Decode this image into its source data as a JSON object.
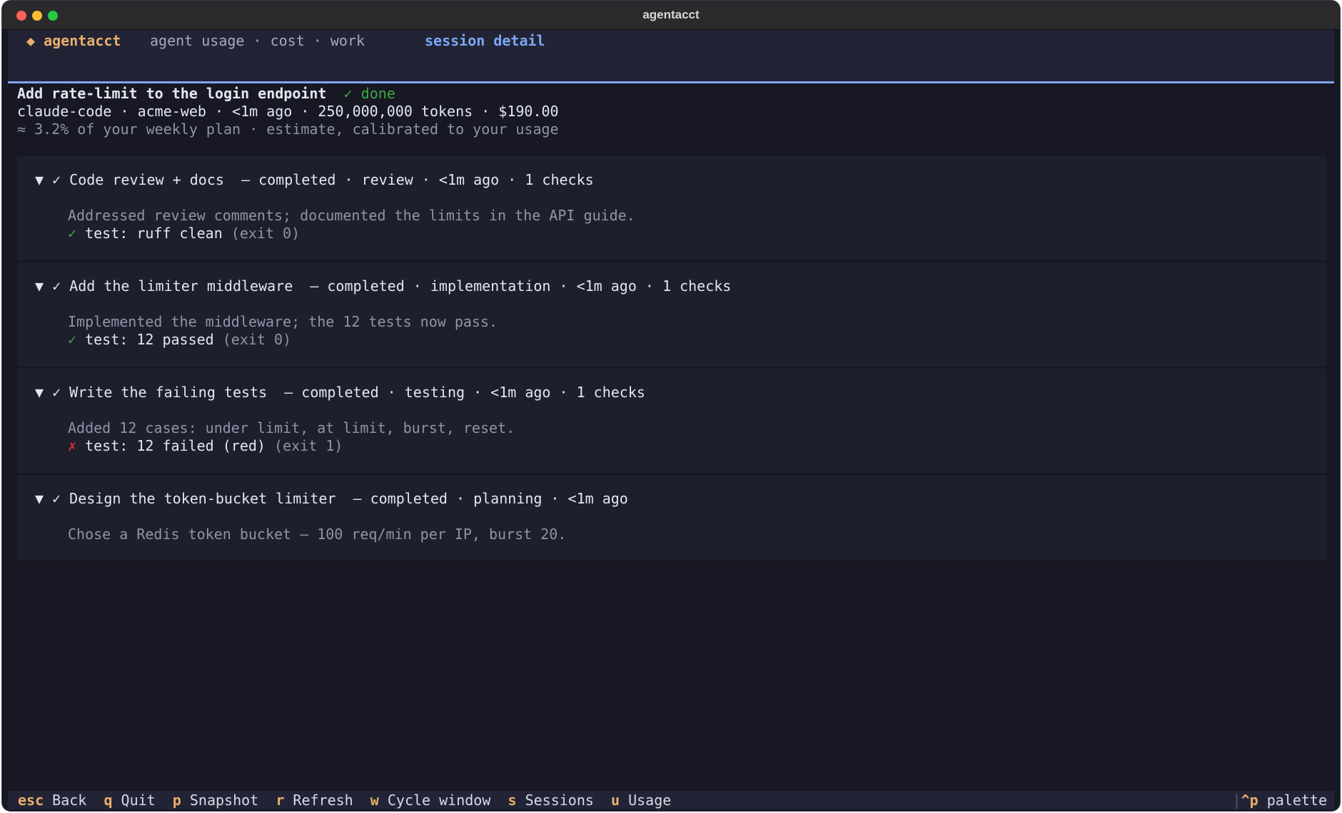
{
  "window": {
    "title": "agentacct"
  },
  "header": {
    "brand_icon": "◆",
    "brand": "agentacct",
    "tagline": "agent usage · cost · work",
    "section": "session detail"
  },
  "session": {
    "title": "Add rate-limit to the login endpoint",
    "status": "✓ done",
    "meta": "claude-code · acme-web · <1m ago · 250,000,000 tokens · $190.00",
    "plan_estimate": "≈ 3.2% of your weekly plan · estimate, calibrated to your usage"
  },
  "tasks": [
    {
      "header": "▼ ✓ Code review + docs  — completed · review · <1m ago · 1 checks",
      "description": "Addressed review comments; documented the limits in the API guide.",
      "check_mark": "✓",
      "check_text": "test: ruff clean",
      "check_exit": "(exit 0)",
      "check_status": "pass"
    },
    {
      "header": "▼ ✓ Add the limiter middleware  — completed · implementation · <1m ago · 1 checks",
      "description": "Implemented the middleware; the 12 tests now pass.",
      "check_mark": "✓",
      "check_text": "test: 12 passed",
      "check_exit": "(exit 0)",
      "check_status": "pass"
    },
    {
      "header": "▼ ✓ Write the failing tests  — completed · testing · <1m ago · 1 checks",
      "description": "Added 12 cases: under limit, at limit, burst, reset.",
      "check_mark": "✗",
      "check_text": "test: 12 failed (red)",
      "check_exit": "(exit 1)",
      "check_status": "fail"
    },
    {
      "header": "▼ ✓ Design the token-bucket limiter  — completed · planning · <1m ago",
      "description": "Chose a Redis token bucket — 100 req/min per IP, burst 20."
    }
  ],
  "footer": {
    "bindings": [
      {
        "key": "esc",
        "label": "Back"
      },
      {
        "key": "q",
        "label": "Quit"
      },
      {
        "key": "p",
        "label": "Snapshot"
      },
      {
        "key": "r",
        "label": "Refresh"
      },
      {
        "key": "w",
        "label": "Cycle window"
      },
      {
        "key": "s",
        "label": "Sessions"
      },
      {
        "key": "u",
        "label": "Usage"
      }
    ],
    "separator": "|",
    "palette_key": "^p",
    "palette_label": "palette"
  },
  "colors": {
    "accent": "#7ea6f5",
    "brand": "#e8b06a",
    "ok": "#3aa845",
    "fail": "#e0303b",
    "background": "#171823",
    "card": "#1e1f2d"
  }
}
